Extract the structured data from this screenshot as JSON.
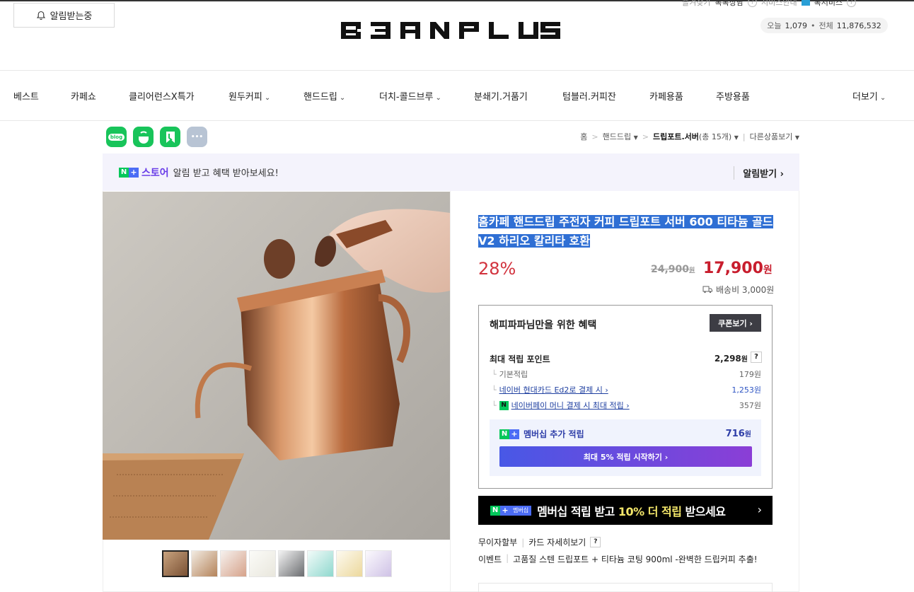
{
  "header": {
    "alarm_button": "알림받는중",
    "logo_text": "BEANPLUS",
    "util_links": [
      "즐겨찾기",
      "톡톡상담",
      "서비스안내",
      "톡서비스"
    ],
    "visitors": {
      "today_label": "오늘",
      "today_value": "1,079",
      "total_label": "전체",
      "total_value": "11,876,532"
    }
  },
  "nav": {
    "items": [
      "베스트",
      "카페쇼",
      "클리어런스X특가",
      "원두커피",
      "핸드드립",
      "더치-콜드브루",
      "분쇄기.거품기",
      "텀블러.커피잔",
      "카페용품",
      "주방용품",
      "더보기"
    ]
  },
  "share": {
    "icons": [
      "blog-icon",
      "talk-icon",
      "band-icon",
      "more-icon"
    ],
    "blog_label": "blog",
    "more_label": "•••"
  },
  "breadcrumb": {
    "home": "홈",
    "level1": "핸드드립",
    "current": "드립포트.서버",
    "count_text": "(총 15개)",
    "other": "다른상품보기"
  },
  "nstore": {
    "store_label": "스토어",
    "message": "알림 받고 혜택 받아보세요!",
    "cta": "알림받기 ›"
  },
  "product": {
    "title": "홈카페 핸드드립 주전자 커피 드립포트 서버 600 티타늄 골드 V2 하리오 칼리타 호환",
    "discount": "28%",
    "original_price": "24,900",
    "price": "17,900",
    "currency": "원",
    "shipping": "배송비 3,000원",
    "thumb_count": 8
  },
  "benefit": {
    "heading": "해피파파님만을 위한 혜택",
    "coupon_button": "쿠폰보기 ›",
    "max_label": "최대 적립 포인트",
    "max_value": "2,298",
    "rows": [
      {
        "label": "기본적립",
        "amount": "179원"
      },
      {
        "label": "네이버 현대카드 Ed2로 결제 시 ›",
        "amount": "1,253원"
      },
      {
        "label": "네이버페이 머니 결제 시 최대 적립 ›",
        "amount": "357원"
      }
    ],
    "member_label": "멤버십 추가 적립",
    "member_value": "716",
    "start_button": "최대 5% 적립 시작하기 ›"
  },
  "banner": {
    "tag": "멤버십",
    "text_before": "멤버십 적립 받고 ",
    "highlight": "10% 더 적립",
    "text_after": " 받으세요"
  },
  "info": {
    "installment": "무이자할부",
    "card_link": "카드 자세히보기",
    "event_label": "이벤트",
    "event_text": "고품질 스텐 드립포트 + 티타늄 코팅 900ml -완벽한 드립커피 추출!"
  }
}
